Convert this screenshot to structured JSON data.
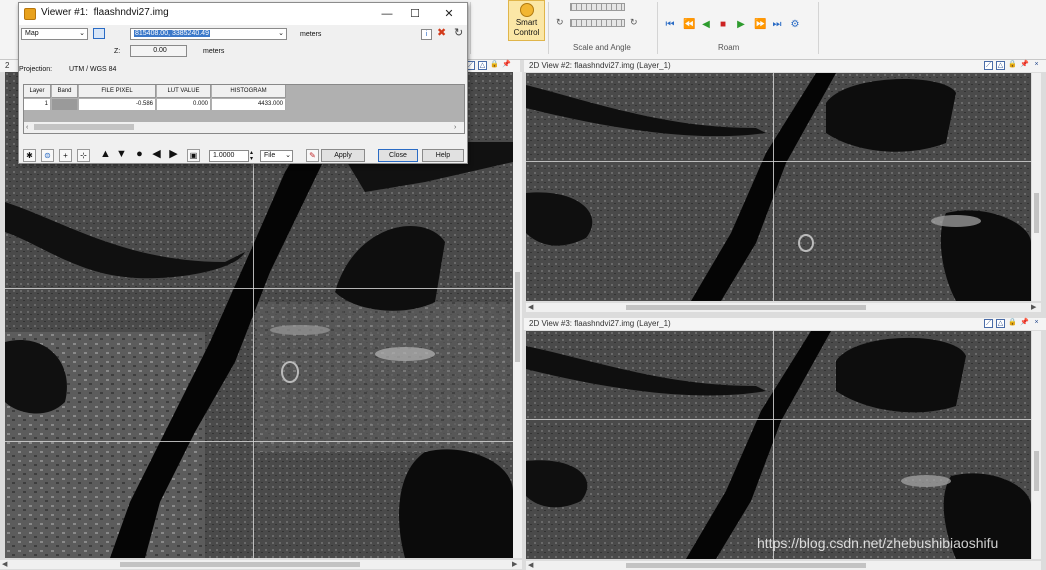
{
  "ribbon": {
    "smart_control_label": "Smart Control",
    "groups": [
      "Scale and Angle",
      "Roam"
    ]
  },
  "main_view": {
    "title_glyph": "2"
  },
  "view2": {
    "title": "2D View #2: flaashndvi27.img (Layer_1)"
  },
  "view3": {
    "title": "2D View #3: flaashndvi27.img (Layer_1)"
  },
  "viewer": {
    "title": "Viewer #1:",
    "filename": "flaashndvi27.img",
    "coord_system": "Map",
    "coordinates": "815408.00, 3385240.49",
    "coord_units": "meters",
    "z_label": "Z:",
    "z_value": "0.00",
    "z_units": "meters",
    "projection_label": "Projection:",
    "projection_value": "UTM / WGS 84",
    "table": {
      "headers": [
        "Layer",
        "Band",
        "FILE PIXEL",
        "LUT VALUE",
        "HISTOGRAM"
      ],
      "row": {
        "layer": "1",
        "band": "",
        "file_pixel": "-0.586",
        "lut_value": "0.000",
        "histogram": "4433.000"
      }
    },
    "zoom_value": "1.0000",
    "file_select": "File",
    "buttons": {
      "apply": "Apply",
      "close": "Close",
      "help": "Help"
    }
  },
  "watermark": "https://blog.csdn.net/zhebushibiaoshifu",
  "icons": [
    "map-pin-icon",
    "minimize-icon",
    "maximize-icon",
    "close-icon",
    "refresh-icon",
    "x-red-icon",
    "crosshair-icon",
    "link-icon",
    "zoom-in-icon",
    "zoom-out-icon",
    "arrow-up-icon",
    "arrow-down-icon",
    "circle-icon",
    "arrow-left-icon",
    "arrow-right-icon",
    "fit-icon",
    "pin-icon",
    "lock-icon"
  ]
}
